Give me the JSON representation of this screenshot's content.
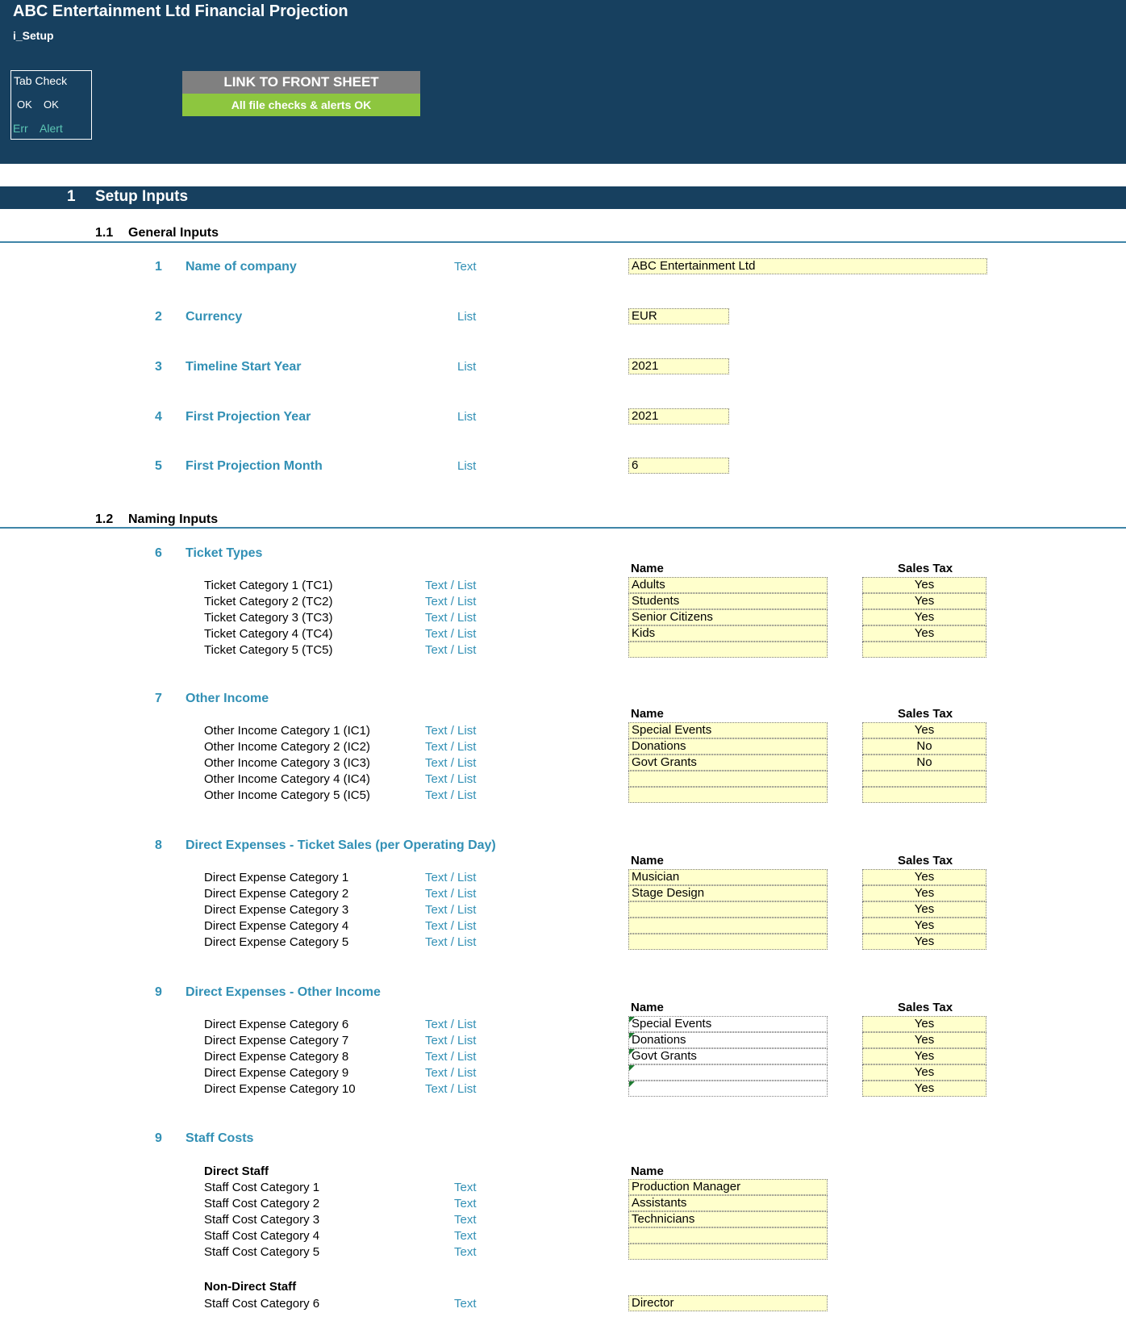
{
  "header": {
    "title": "ABC Entertainment Ltd Financial Projection",
    "sheet": "i_Setup",
    "tab_check": {
      "title": "Tab Check",
      "ok1": "OK",
      "ok2": "OK",
      "err": "Err",
      "alert": "Alert"
    },
    "link_button": "LINK TO FRONT SHEET",
    "status": "All file checks & alerts OK"
  },
  "colors": {
    "band": "#17405f",
    "accent": "#3290b5",
    "input_fill": "#ffffcc",
    "ok_green": "#8dc63f",
    "err_teal": "#5cc6b4"
  },
  "section": {
    "number": "1",
    "title": "Setup Inputs"
  },
  "general": {
    "number": "1.1",
    "title": "General Inputs",
    "items": [
      {
        "num": "1",
        "label": "Name of company",
        "type": "Text",
        "value": "ABC Entertainment Ltd"
      },
      {
        "num": "2",
        "label": "Currency",
        "type": "List",
        "value": "EUR"
      },
      {
        "num": "3",
        "label": "Timeline Start Year",
        "type": "List",
        "value": "2021"
      },
      {
        "num": "4",
        "label": "First Projection Year",
        "type": "List",
        "value": "2021"
      },
      {
        "num": "5",
        "label": "First Projection Month",
        "type": "List",
        "value": "6"
      }
    ]
  },
  "naming": {
    "number": "1.2",
    "title": "Naming Inputs",
    "col_name": "Name",
    "col_tax": "Sales Tax",
    "type_text": "Text",
    "type_sep": "/",
    "type_list": "List",
    "groups": [
      {
        "num": "6",
        "title": "Ticket Types",
        "rows": [
          {
            "label": "Ticket Category 1 (TC1)",
            "name": "Adults",
            "tax": "Yes"
          },
          {
            "label": "Ticket Category 2 (TC2)",
            "name": "Students",
            "tax": "Yes"
          },
          {
            "label": "Ticket Category 3 (TC3)",
            "name": "Senior Citizens",
            "tax": "Yes"
          },
          {
            "label": "Ticket Category 4 (TC4)",
            "name": "Kids",
            "tax": "Yes"
          },
          {
            "label": "Ticket Category 5 (TC5)",
            "name": "",
            "tax": ""
          }
        ]
      },
      {
        "num": "7",
        "title": "Other Income",
        "rows": [
          {
            "label": "Other Income Category 1 (IC1)",
            "name": "Special Events",
            "tax": "Yes"
          },
          {
            "label": "Other Income Category 2 (IC2)",
            "name": "Donations",
            "tax": "No"
          },
          {
            "label": "Other Income Category 3 (IC3)",
            "name": "Govt Grants",
            "tax": "No"
          },
          {
            "label": "Other Income Category 4 (IC4)",
            "name": "",
            "tax": ""
          },
          {
            "label": "Other Income Category 5 (IC5)",
            "name": "",
            "tax": ""
          }
        ]
      },
      {
        "num": "8",
        "title": "Direct Expenses - Ticket Sales (per Operating Day)",
        "rows": [
          {
            "label": "Direct Expense Category 1",
            "name": "Musician",
            "tax": "Yes"
          },
          {
            "label": "Direct Expense Category 2",
            "name": "Stage Design",
            "tax": "Yes"
          },
          {
            "label": "Direct Expense Category 3",
            "name": "",
            "tax": "Yes"
          },
          {
            "label": "Direct Expense Category 4",
            "name": "",
            "tax": "Yes"
          },
          {
            "label": "Direct Expense Category 5",
            "name": "",
            "tax": "Yes"
          }
        ]
      },
      {
        "num": "9",
        "title": "Direct Expenses - Other Income",
        "rows": [
          {
            "label": "Direct Expense Category 6",
            "name": "Special Events",
            "tax": "Yes"
          },
          {
            "label": "Direct Expense Category 7",
            "name": "Donations",
            "tax": "Yes"
          },
          {
            "label": "Direct Expense Category 8",
            "name": "Govt Grants",
            "tax": "Yes"
          },
          {
            "label": "Direct Expense Category 9",
            "name": "",
            "tax": "Yes"
          },
          {
            "label": "Direct Expense Category 10",
            "name": "",
            "tax": "Yes"
          }
        ]
      }
    ],
    "staff": {
      "num": "9",
      "title": "Staff Costs",
      "direct_title": "Direct Staff",
      "direct_rows": [
        {
          "label": "Staff Cost Category 1",
          "type": "Text",
          "name": "Production Manager"
        },
        {
          "label": "Staff Cost Category 2",
          "type": "Text",
          "name": "Assistants"
        },
        {
          "label": "Staff Cost Category 3",
          "type": "Text",
          "name": "Technicians"
        },
        {
          "label": "Staff Cost Category 4",
          "type": "Text",
          "name": ""
        },
        {
          "label": "Staff Cost Category 5",
          "type": "Text",
          "name": ""
        }
      ],
      "nondirect_title": "Non-Direct Staff",
      "nondirect_rows": [
        {
          "label": "Staff Cost Category 6",
          "type": "Text",
          "name": "Director"
        }
      ]
    }
  }
}
